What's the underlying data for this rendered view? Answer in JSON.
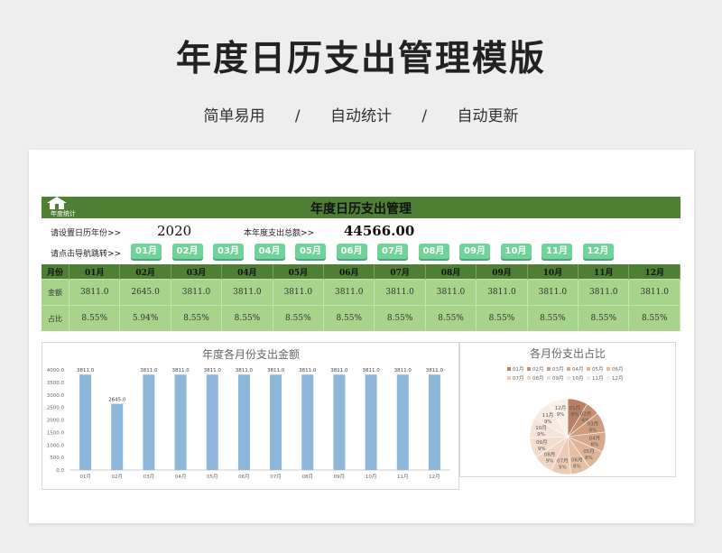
{
  "page": {
    "title": "年度日历支出管理模版",
    "subtitle": [
      "简单易用",
      "/",
      "自动统计",
      "/",
      "自动更新"
    ]
  },
  "sheet": {
    "header_title": "年度日历支出管理",
    "home_label": "年度统计",
    "year_label": "请设置日历年份>>",
    "year_value": "2020",
    "total_label": "本年度支出总额>>",
    "total_value": "44566.00",
    "nav_label": "请点击导航跳转>>",
    "nav_buttons": [
      "01月",
      "02月",
      "03月",
      "04月",
      "05月",
      "06月",
      "07月",
      "08月",
      "09月",
      "10月",
      "11月",
      "12月"
    ],
    "table": {
      "header": [
        "月份",
        "01月",
        "02月",
        "03月",
        "04月",
        "05月",
        "06月",
        "07月",
        "08月",
        "09月",
        "10月",
        "11月",
        "12月"
      ],
      "amount_label": "金额",
      "amounts": [
        "3811.0",
        "2645.0",
        "3811.0",
        "3811.0",
        "3811.0",
        "3811.0",
        "3811.0",
        "3811.0",
        "3811.0",
        "3811.0",
        "3811.0",
        "3811.0"
      ],
      "ratio_label": "占比",
      "ratios": [
        "8.55%",
        "5.94%",
        "8.55%",
        "8.55%",
        "8.55%",
        "8.55%",
        "8.55%",
        "8.55%",
        "8.55%",
        "8.55%",
        "8.55%",
        "8.55%"
      ]
    },
    "colors": {
      "header_green": "#4e7f34",
      "cell_green": "#a7d38a",
      "button_green": "#6fd39a",
      "bar_blue": "#8db6d9"
    }
  },
  "chart_data": [
    {
      "type": "bar",
      "title": "年度各月份支出金额",
      "categories": [
        "01月",
        "02月",
        "03月",
        "04月",
        "05月",
        "06月",
        "07月",
        "08月",
        "09月",
        "10月",
        "11月",
        "12月"
      ],
      "values": [
        3811.0,
        2645.0,
        3811.0,
        3811.0,
        3811.0,
        3811.0,
        3811.0,
        3811.0,
        3811.0,
        3811.0,
        3811.0,
        3811.0
      ],
      "data_labels": [
        "3811.0",
        "2645.0",
        "3811.0",
        "3811.0",
        "3811.0",
        "3811.0",
        "3811.0",
        "3811.0",
        "3811.0",
        "3811.0",
        "3811.0",
        "3811.0"
      ],
      "yticks": [
        "0.0",
        "500.0",
        "1000.0",
        "1500.0",
        "2000.0",
        "2500.0",
        "3000.0",
        "3500.0",
        "4000.0"
      ],
      "ylim": [
        0,
        4000
      ],
      "grid": false
    },
    {
      "type": "pie",
      "title": "各月份支出占比",
      "categories": [
        "01月",
        "02月",
        "03月",
        "04月",
        "05月",
        "06月",
        "07月",
        "08月",
        "09月",
        "10月",
        "11月",
        "12月"
      ],
      "values": [
        3811.0,
        2645.0,
        3811.0,
        3811.0,
        3811.0,
        3811.0,
        3811.0,
        3811.0,
        3811.0,
        3811.0,
        3811.0,
        3811.0
      ],
      "slice_labels": [
        "8%",
        "6%",
        "8%",
        "8%",
        "8%",
        "8%",
        "9%",
        "9%",
        "9%",
        "9%",
        "9%",
        "9%"
      ],
      "legend_position": "top",
      "colors": [
        "#b98063",
        "#c58e70",
        "#cf9c7f",
        "#d8a98c",
        "#dfb59a",
        "#e6c0a6",
        "#ecccb6",
        "#f0d6c3",
        "#f3ddcd",
        "#f6e4d8",
        "#f8eae1",
        "#faf0e9"
      ]
    }
  ]
}
